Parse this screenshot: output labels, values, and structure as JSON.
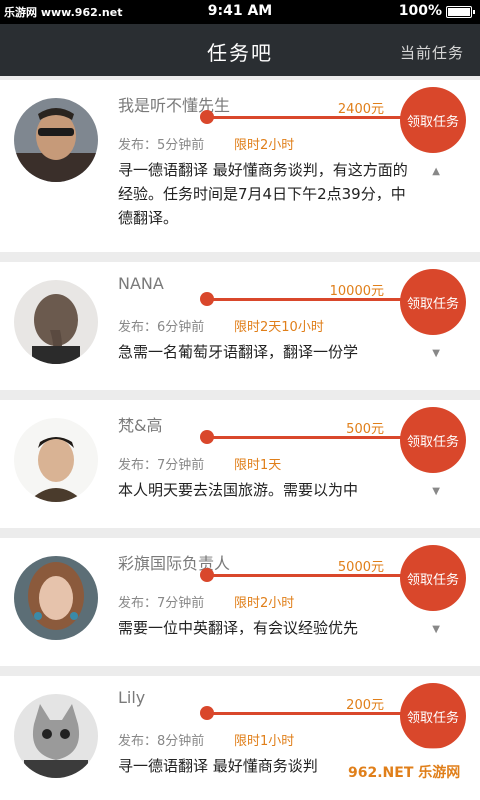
{
  "status_bar": {
    "watermark": "乐游网 www.962.net",
    "time": "9:41 AM",
    "battery": "100%"
  },
  "nav": {
    "title": "任务吧",
    "right_action": "当前任务"
  },
  "tasks": [
    {
      "user": "我是听不懂先生",
      "price": "2400元",
      "claim": "领取任务",
      "posted": "发布：5分钟前",
      "limit": "限时2小时",
      "desc": "寻一德语翻译 最好懂商务谈判，有这方面的经验。任务时间是7月4日下午2点39分，中德翻译。",
      "toggle": "▲"
    },
    {
      "user": "NANA",
      "price": "10000元",
      "claim": "领取任务",
      "posted": "发布：6分钟前",
      "limit": "限时2天10小时",
      "desc": "急需一名葡萄牙语翻译，翻译一份学",
      "toggle": "▼"
    },
    {
      "user": "梵&高",
      "price": "500元",
      "claim": "领取任务",
      "posted": "发布：7分钟前",
      "limit": "限时1天",
      "desc": "本人明天要去法国旅游。需要以为中",
      "toggle": "▼"
    },
    {
      "user": "彩旗国际负责人",
      "price": "5000元",
      "claim": "领取任务",
      "posted": "发布：7分钟前",
      "limit": "限时2小时",
      "desc": "需要一位中英翻译，有会议经验优先",
      "toggle": "▼"
    },
    {
      "user": "Lily",
      "price": "200元",
      "claim": "领取任务",
      "posted": "发布：8分钟前",
      "limit": "限时1小时",
      "desc": "寻一德语翻译 最好懂商务谈判",
      "toggle": ""
    }
  ],
  "footer_watermark": "962.NET 乐游网"
}
